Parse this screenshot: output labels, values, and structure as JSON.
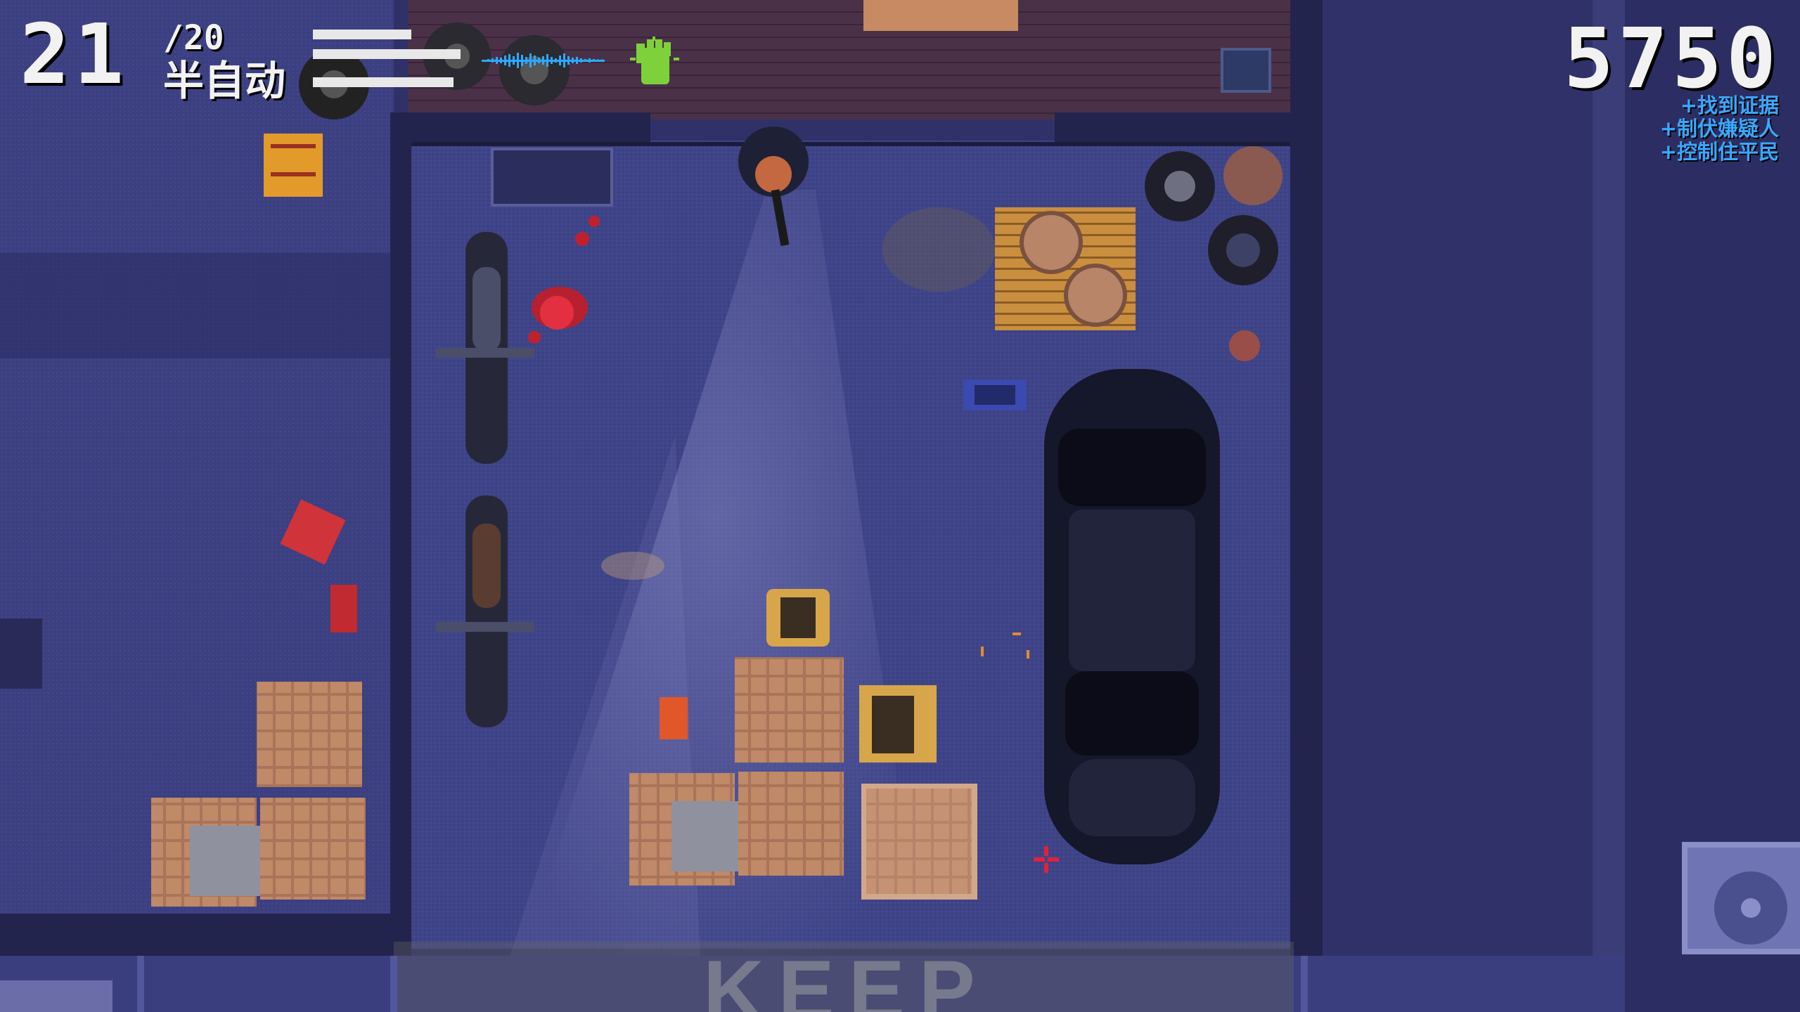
{
  "hud": {
    "ammo_current": "21",
    "ammo_reserve": "/20",
    "fire_mode": "半自动",
    "score": "5750",
    "objectives": [
      "+找到证据",
      "+制伏嫌疑人",
      "+控制住平民"
    ],
    "objective_color": "#3aa8ff",
    "noise_meter_color": "#2ea8ff",
    "fist_icon_color": "#7ed13a",
    "crosshair_color": "#e0223a"
  },
  "floor_text": "KEEP"
}
